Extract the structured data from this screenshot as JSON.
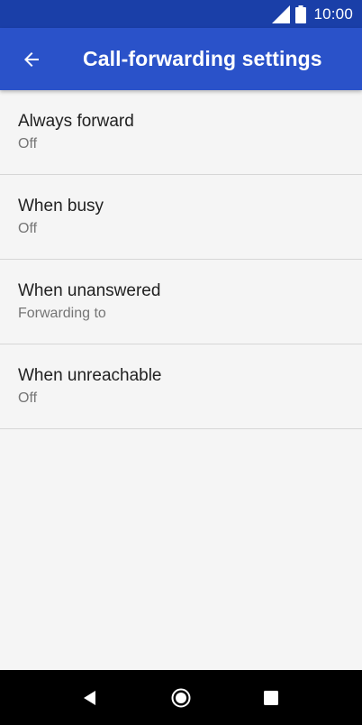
{
  "status_bar": {
    "time": "10:00",
    "signal_icon": "cellular-signal-icon",
    "battery_icon": "battery-icon"
  },
  "app_bar": {
    "title": "Call-forwarding settings",
    "back_icon": "arrow-left-icon"
  },
  "items": [
    {
      "title": "Always forward",
      "subtitle": "Off"
    },
    {
      "title": "When busy",
      "subtitle": "Off"
    },
    {
      "title": "When unanswered",
      "subtitle": "Forwarding to"
    },
    {
      "title": "When unreachable",
      "subtitle": "Off"
    }
  ],
  "nav_bar": {
    "back_icon": "nav-back-triangle-icon",
    "home_icon": "nav-home-circle-icon",
    "recents_icon": "nav-recents-square-icon"
  },
  "colors": {
    "status_bar": "#1a3fa8",
    "app_bar": "#2a52c9",
    "background": "#f5f5f5",
    "nav_bar": "#000000"
  }
}
